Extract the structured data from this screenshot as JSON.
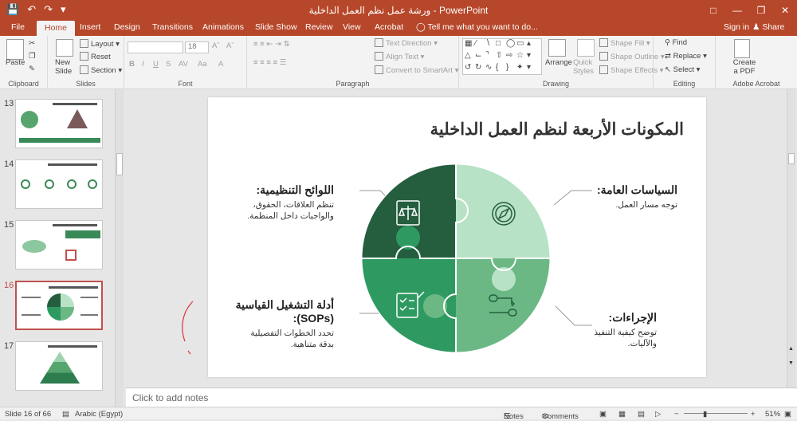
{
  "window": {
    "title": "ورشة عمل نظم العمل الداخلية - PowerPoint",
    "restore_icon": "restore-icon",
    "buttons": [
      "—",
      "❐",
      "✕"
    ]
  },
  "qat": [
    "save-icon",
    "undo-icon",
    "redo-icon",
    "customize-icon"
  ],
  "tabs": [
    "File",
    "Home",
    "Insert",
    "Design",
    "Transitions",
    "Animations",
    "Slide Show",
    "Review",
    "View",
    "Acrobat"
  ],
  "active_tab": "Home",
  "tell_me": "Tell me what you want to do...",
  "sign_in": "Sign in",
  "share": "Share",
  "ribbon": {
    "clipboard": {
      "label": "Clipboard",
      "paste": "Paste"
    },
    "slides": {
      "label": "Slides",
      "new_slide": "New Slide",
      "layout": "Layout",
      "reset": "Reset",
      "section": "Section"
    },
    "font": {
      "label": "Font",
      "size": "18"
    },
    "paragraph": {
      "label": "Paragraph",
      "text_direction": "Text Direction",
      "align_text": "Align Text",
      "smartart": "Convert to SmartArt"
    },
    "drawing": {
      "label": "Drawing",
      "arrange": "Arrange",
      "quick_styles": "Quick Styles",
      "shape_fill": "Shape Fill",
      "shape_outline": "Shape Outline",
      "shape_effects": "Shape Effects"
    },
    "editing": {
      "label": "Editing",
      "find": "Find",
      "replace": "Replace",
      "select": "Select"
    },
    "acrobat": {
      "label": "Adobe Acrobat",
      "create_pdf": "Create a PDF"
    }
  },
  "thumbnails": [
    {
      "num": "13",
      "selected": false
    },
    {
      "num": "14",
      "selected": false
    },
    {
      "num": "15",
      "selected": false
    },
    {
      "num": "16",
      "selected": true
    },
    {
      "num": "17",
      "selected": false
    }
  ],
  "slide": {
    "title": "المكونات الأربعة لنظم العمل الداخلية",
    "sections": [
      {
        "heading": "السياسات العامة:",
        "desc": [
          "توجه مسار العمل."
        ]
      },
      {
        "heading": "اللوائح التنظيمية:",
        "desc": [
          "تنظم العلاقات، الحقوق،",
          "والواجبات داخل المنظمة."
        ]
      },
      {
        "heading": "الإجراءات:",
        "desc": [
          "توضح كيفية التنفيذ",
          "والآليات."
        ]
      },
      {
        "heading": "أدلة التشغيل القياسية (SOPs):",
        "desc": [
          "تحدد الخطوات التفصيلية",
          "بدقة متناهية."
        ]
      }
    ],
    "colors": {
      "q_top_right": "#b8e2c6",
      "q_top_left": "#245e3f",
      "q_bottom_left": "#2e9a61",
      "q_bottom_right": "#6bb885"
    },
    "icons": [
      "compass-icon",
      "scales-document-icon",
      "checklist-icon",
      "process-flow-icon"
    ]
  },
  "notes_placeholder": "Click to add notes",
  "status": {
    "slide_info": "Slide 16 of 66",
    "language": "Arabic (Egypt)",
    "notes": "Notes",
    "comments": "Comments",
    "zoom": "51%"
  }
}
